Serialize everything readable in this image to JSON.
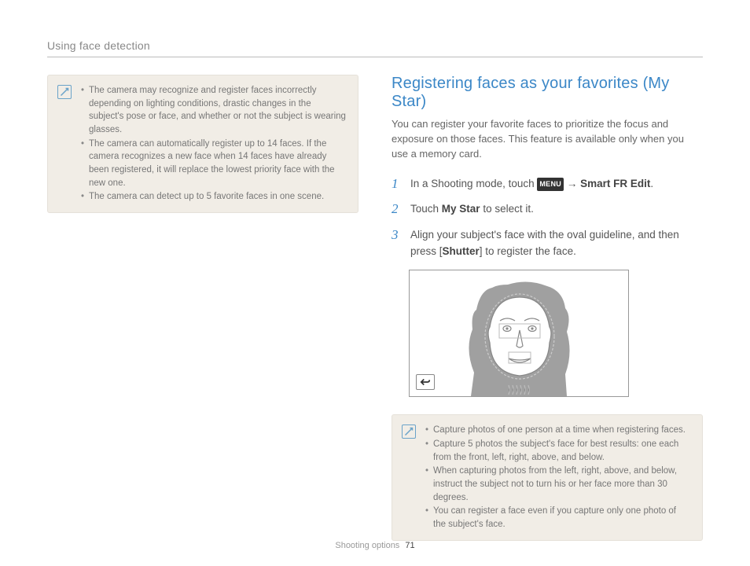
{
  "header": "Using face detection",
  "left_note": {
    "items": [
      "The camera may recognize and register faces incorrectly depending on lighting conditions, drastic changes in the subject's pose or face, and whether or not the subject is wearing glasses.",
      "The camera can automatically register up to 14 faces. If the camera recognizes a new face when 14 faces have already been registered, it will replace the lowest priority face with the new one.",
      "The camera can detect up to 5 favorite faces in one scene."
    ]
  },
  "right": {
    "title": "Registering faces as your favorites (My Star)",
    "intro": "You can register your favorite faces to prioritize the focus and exposure on those faces. This feature is available only when you use a memory card.",
    "menu_label": "MENU",
    "steps": {
      "s1_pre": "In a Shooting mode, touch ",
      "s1_arrow": " → ",
      "s1_bold": "Smart FR Edit",
      "s1_post": ".",
      "s2_pre": "Touch ",
      "s2_bold": "My Star",
      "s2_post": " to select it.",
      "s3_pre": "Align your subject's face with the oval guideline, and then press [",
      "s3_bold": "Shutter",
      "s3_post": "] to register the face."
    }
  },
  "right_note": {
    "items": [
      "Capture photos of one person at a time when registering faces.",
      "Capture 5 photos the subject's face for best results: one each from the front, left, right, above, and below.",
      "When capturing photos from the left, right, above, and below, instruct the subject not to turn his or her face more than 30 degrees.",
      "You can register a face even if you capture only one photo of the subject's face."
    ]
  },
  "footer": {
    "section": "Shooting options",
    "page": "71"
  }
}
